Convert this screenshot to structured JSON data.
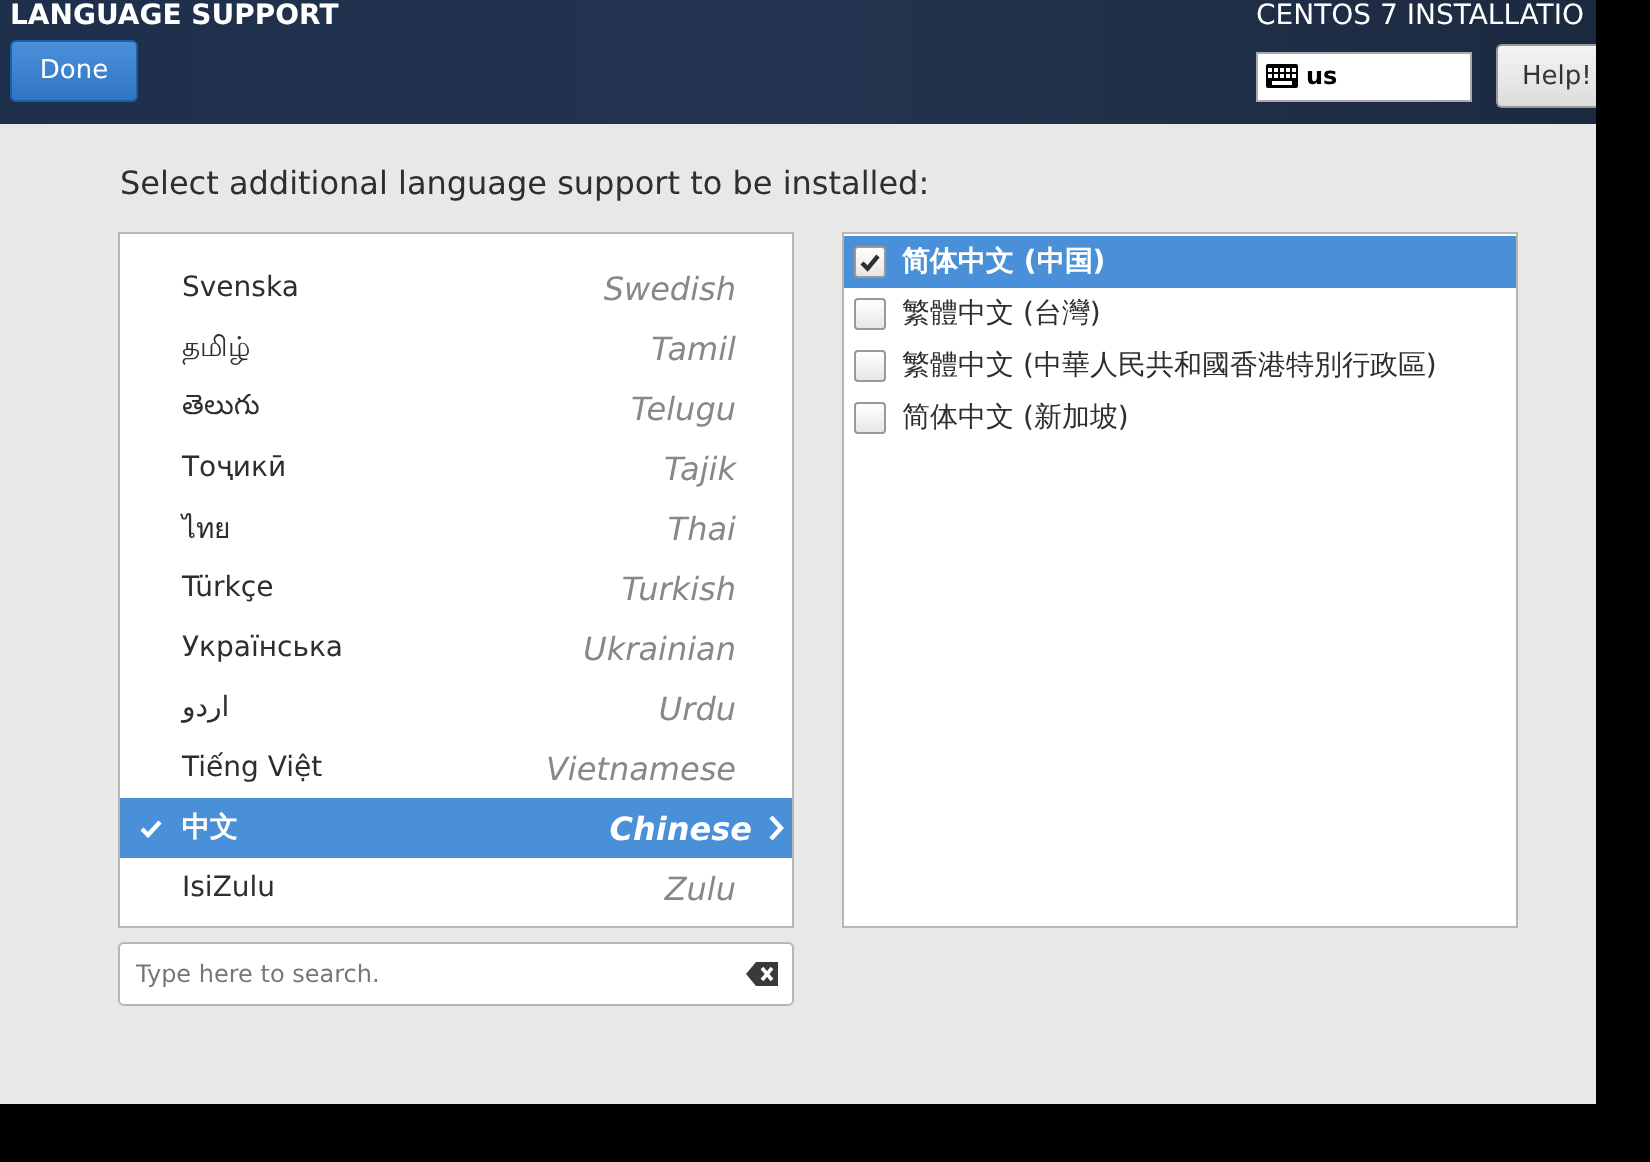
{
  "header": {
    "title": "LANGUAGE SUPPORT",
    "done_button": "Done",
    "product": "CENTOS 7 INSTALLATIO",
    "keyboard_layout": "us",
    "help_button": "Help!"
  },
  "prompt": "Select additional language support to be installed:",
  "languages": [
    {
      "native": "Svenska",
      "english": "Swedish",
      "selected": false,
      "checked": false
    },
    {
      "native": "தமிழ்",
      "english": "Tamil",
      "selected": false,
      "checked": false
    },
    {
      "native": "తెలుగు",
      "english": "Telugu",
      "selected": false,
      "checked": false
    },
    {
      "native": "Тоҷикӣ",
      "english": "Tajik",
      "selected": false,
      "checked": false
    },
    {
      "native": "ไทย",
      "english": "Thai",
      "selected": false,
      "checked": false
    },
    {
      "native": "Türkçe",
      "english": "Turkish",
      "selected": false,
      "checked": false
    },
    {
      "native": "Українська",
      "english": "Ukrainian",
      "selected": false,
      "checked": false
    },
    {
      "native": "اردو",
      "english": "Urdu",
      "selected": false,
      "checked": false
    },
    {
      "native": "Tiếng Việt",
      "english": "Vietnamese",
      "selected": false,
      "checked": false
    },
    {
      "native": "中文",
      "english": "Chinese",
      "selected": true,
      "checked": true
    },
    {
      "native": "IsiZulu",
      "english": "Zulu",
      "selected": false,
      "checked": false
    }
  ],
  "search": {
    "placeholder": "Type here to search."
  },
  "locales": [
    {
      "label": "简体中文 (中国)",
      "checked": true,
      "selected": true
    },
    {
      "label": "繁體中文 (台灣)",
      "checked": false,
      "selected": false
    },
    {
      "label": "繁體中文 (中華人民共和國香港特別行政區)",
      "checked": false,
      "selected": false
    },
    {
      "label": "简体中文 (新加坡)",
      "checked": false,
      "selected": false
    }
  ]
}
